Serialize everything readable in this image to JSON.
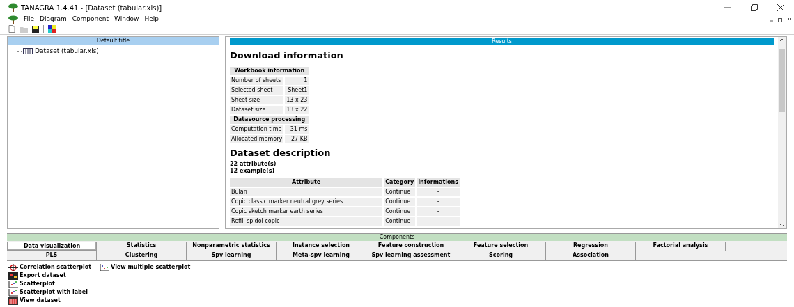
{
  "window": {
    "title": "TANAGRA 1.4.41 - [Dataset (tabular.xls)]"
  },
  "menu": [
    "File",
    "Diagram",
    "Component",
    "Window",
    "Help"
  ],
  "diagram": {
    "title": "Default title",
    "items": [
      {
        "label": "Dataset (tabular.xls)",
        "selected": false
      }
    ]
  },
  "results": {
    "title": "Results",
    "download_heading": "Download information",
    "info_table": [
      {
        "kind": "header",
        "label": "Workbook information"
      },
      {
        "kind": "row",
        "label": "Number of sheets",
        "value": "1"
      },
      {
        "kind": "row",
        "label": "Selected sheet",
        "value": "Sheet1"
      },
      {
        "kind": "row",
        "label": "Sheet size",
        "value": "13 x 23"
      },
      {
        "kind": "row",
        "label": "Dataset size",
        "value": "13 x 22"
      },
      {
        "kind": "header",
        "label": "Datasource processing"
      },
      {
        "kind": "row",
        "label": "Computation time",
        "value": "31 ms"
      },
      {
        "kind": "row",
        "label": "Allocated memory",
        "value": "27 KB"
      }
    ],
    "dataset_heading": "Dataset description",
    "summary": [
      "22 attribute(s)",
      "12 example(s)"
    ],
    "attributes": {
      "columns": [
        "Attribute",
        "Category",
        "Informations"
      ],
      "rows": [
        [
          "Bulan",
          "Continue",
          "-"
        ],
        [
          "Copic classic marker neutral grey series",
          "Continue",
          "-"
        ],
        [
          "Copic sketch marker earth series",
          "Continue",
          "-"
        ],
        [
          "Refill spidol copic",
          "Continue",
          "-"
        ]
      ]
    }
  },
  "components": {
    "title": "Components",
    "tabs": [
      [
        {
          "label": "Data visualization",
          "selected": true
        },
        {
          "label": "Statistics",
          "selected": false
        },
        {
          "label": "Nonparametric statistics",
          "selected": false
        },
        {
          "label": "Instance selection",
          "selected": false
        },
        {
          "label": "Feature construction",
          "selected": false
        },
        {
          "label": "Feature selection",
          "selected": false
        },
        {
          "label": "Regression",
          "selected": false
        },
        {
          "label": "Factorial analysis",
          "selected": false
        }
      ],
      [
        {
          "label": "PLS",
          "selected": false
        },
        {
          "label": "Clustering",
          "selected": false
        },
        {
          "label": "Spv learning",
          "selected": false
        },
        {
          "label": "Meta-spv learning",
          "selected": false
        },
        {
          "label": "Spv learning assessment",
          "selected": false
        },
        {
          "label": "Scoring",
          "selected": false
        },
        {
          "label": "Association",
          "selected": false
        }
      ]
    ],
    "items": [
      [
        {
          "label": "Correlation scatterplot",
          "kind": "crosshair"
        },
        {
          "label": "Export dataset",
          "kind": "export"
        },
        {
          "label": "Scatterplot",
          "kind": "scatter"
        },
        {
          "label": "Scatterplot with label",
          "kind": "scatter"
        },
        {
          "label": "View dataset",
          "kind": "table"
        }
      ],
      [
        {
          "label": "View multiple scatterplot",
          "kind": "multi"
        }
      ]
    ]
  }
}
